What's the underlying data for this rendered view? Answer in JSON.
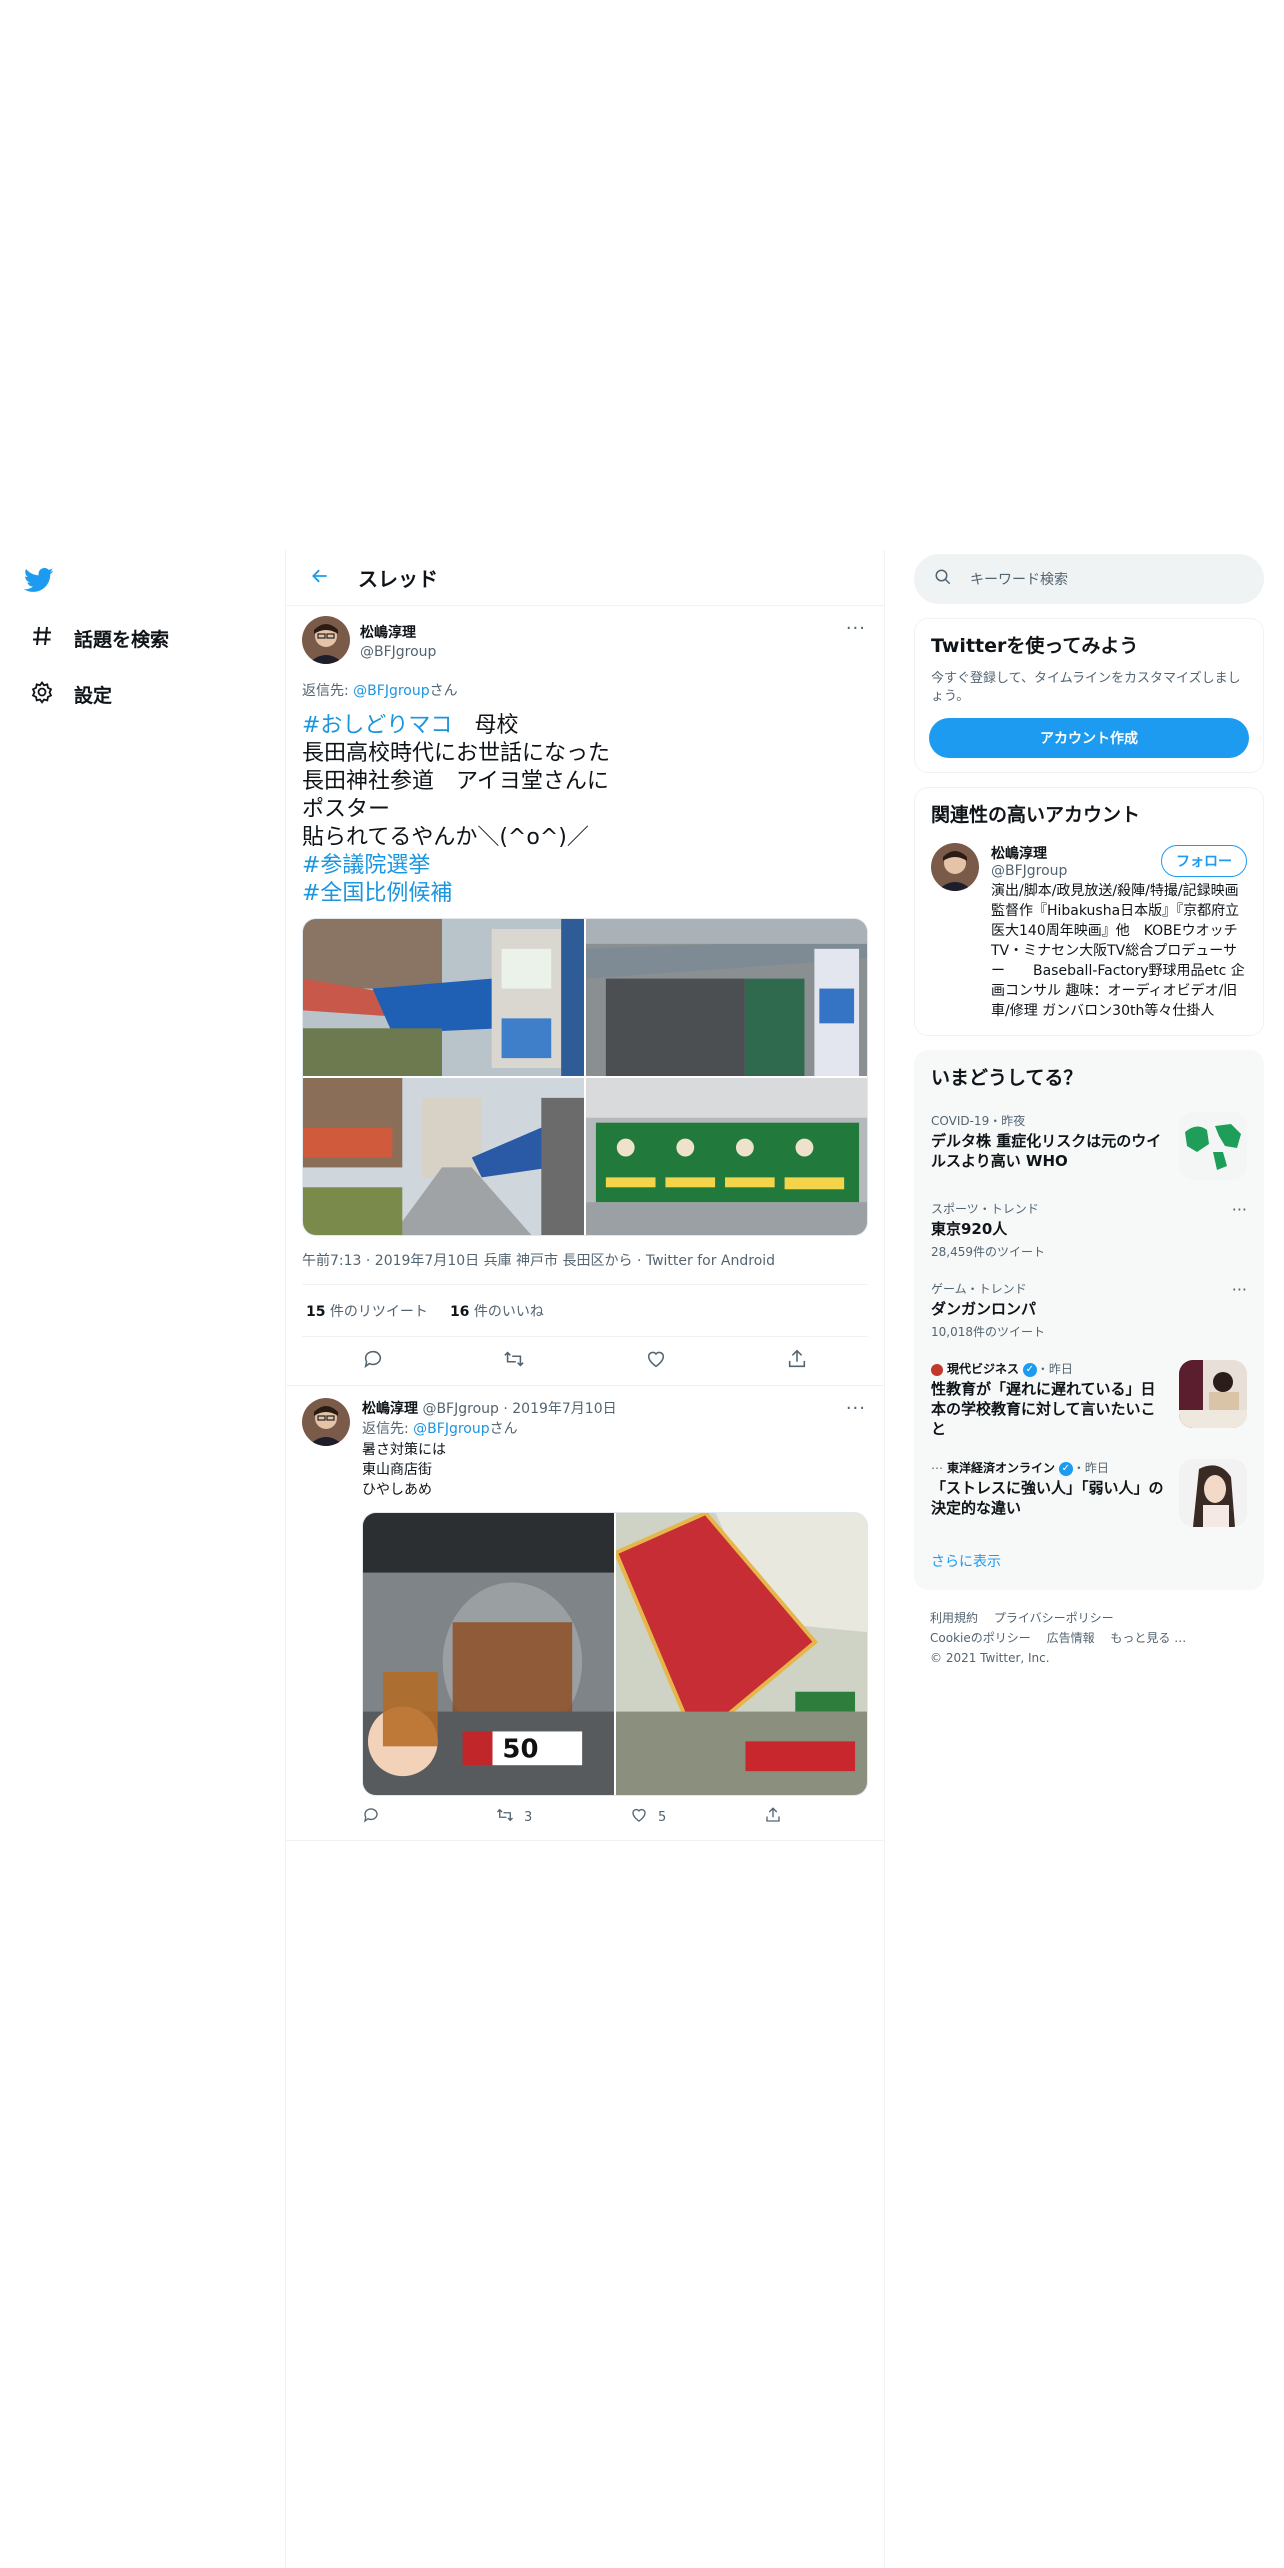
{
  "nav": {
    "explore_label": "話題を検索",
    "settings_label": "設定"
  },
  "header": {
    "title": "スレッド"
  },
  "main_tweet": {
    "author_name": "松嶋淳理",
    "author_handle": "@BFJgroup",
    "reply_to_prefix": "返信先: ",
    "reply_to_handle": "@BFJgroup",
    "reply_to_suffix": "さん",
    "text_hashtag1": "#おしどりマコ",
    "text_body": "　母校\n長田高校時代にお世話になった\n長田神社参道　アイヨ堂さんに\nポスター\n貼られてるやんか＼(^o^)／",
    "text_hashtag2": "#参議院選挙",
    "text_hashtag3": "#全国比例候補",
    "meta": "午前7:13 · 2019年7月10日 兵庫 神戸市 長田区から · Twitter for Android",
    "retweets_count": "15",
    "retweets_label": " 件のリツイート",
    "likes_count": "16",
    "likes_label": " 件のいいね"
  },
  "reply_tweet": {
    "author_name": "松嶋淳理",
    "author_handle": "@BFJgroup",
    "date": "2019年7月10日",
    "reply_to_prefix": "返信先: ",
    "reply_to_handle": "@BFJgroup",
    "reply_to_suffix": "さん",
    "text": "暑さ対策には\n東山商店街\nひやしあめ",
    "retweets": "3",
    "likes": "5"
  },
  "search": {
    "placeholder": "キーワード検索"
  },
  "signup": {
    "title": "Twitterを使ってみよう",
    "subtitle": "今すぐ登録して、タイムラインをカスタマイズしましょう。",
    "button": "アカウント作成"
  },
  "related": {
    "title": "関連性の高いアカウント",
    "name": "松嶋淳理",
    "handle": "@BFJgroup",
    "follow": "フォロー",
    "bio": "演出/脚本/政見放送/殺陣/特撮/記録映画　　監督作『Hibakusha日本版』『京都府立医大140周年映画』他　KOBEウオッチTV・ミナセン大阪TV総合プロデューサー　　Baseball-Factory野球用品etc 企画コンサル 趣味：オーディオビデオ/旧車/修理 ガンバロン30th等々仕掛人"
  },
  "trends": {
    "title": "いまどうしてる？",
    "items": [
      {
        "meta": "COVID-19・昨夜",
        "title": "デルタ株 重症化リスクは元のウイルスより高い WHO",
        "count": ""
      },
      {
        "meta": "スポーツ・トレンド",
        "title": "東京920人",
        "count": "28,459件のツイート"
      },
      {
        "meta": "ゲーム・トレンド",
        "title": "ダンガンロンパ",
        "count": "10,018件のツイート"
      },
      {
        "meta_source": "現代ビジネス",
        "meta_time": "・昨日",
        "title": "性教育が「遅れに遅れている」日本の学校教育に対して言いたいこと",
        "count": ""
      },
      {
        "meta_source": "東洋経済オンライン",
        "meta_time": "・昨日",
        "title": "「ストレスに強い人」「弱い人」の決定的な違い",
        "count": ""
      }
    ],
    "show_more": "さらに表示"
  },
  "footer": {
    "terms": "利用規約",
    "privacy": "プライバシーポリシー",
    "cookie": "Cookieのポリシー",
    "ads": "広告情報",
    "more": "もっと見る …",
    "copyright": "© 2021 Twitter, Inc."
  },
  "colors": {
    "accent": "#1d9bf0",
    "link": "#1b95e0",
    "muted": "#536471"
  }
}
